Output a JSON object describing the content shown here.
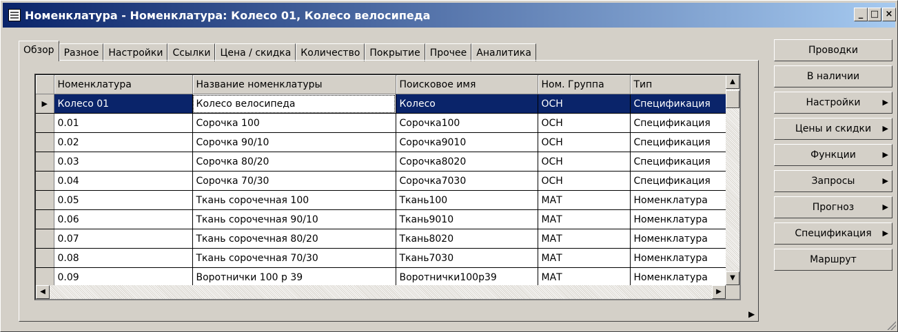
{
  "window": {
    "title": "Номенклатура - Номенклатура: Колесо 01, Колесо велосипеда",
    "minimize": "_",
    "maximize": "□",
    "close": "×"
  },
  "tabs": [
    "Обзор",
    "Разное",
    "Настройки",
    "Ссылки",
    "Цена / скидка",
    "Количество",
    "Покрытие",
    "Прочее",
    "Аналитика"
  ],
  "grid": {
    "columns": [
      "Номенклатура",
      "Название номенклатуры",
      "Поисковое имя",
      "Ном. Группа",
      "Тип"
    ],
    "rows": [
      [
        "Колесо 01",
        "Колесо велосипеда",
        "Колесо",
        "ОСН",
        "Спецификация"
      ],
      [
        "0.01",
        "Сорочка 100",
        "Сорочка100",
        "ОСН",
        "Спецификация"
      ],
      [
        "0.02",
        "Сорочка 90/10",
        "Сорочка9010",
        "ОСН",
        "Спецификация"
      ],
      [
        "0.03",
        "Сорочка 80/20",
        "Сорочка8020",
        "ОСН",
        "Спецификация"
      ],
      [
        "0.04",
        "Сорочка 70/30",
        "Сорочка7030",
        "ОСН",
        "Спецификация"
      ],
      [
        "0.05",
        "Ткань сорочечная 100",
        "Ткань100",
        "МАТ",
        "Номенклатура"
      ],
      [
        "0.06",
        "Ткань сорочечная 90/10",
        "Ткань9010",
        "МАТ",
        "Номенклатура"
      ],
      [
        "0.07",
        "Ткань сорочечная 80/20",
        "Ткань8020",
        "МАТ",
        "Номенклатура"
      ],
      [
        "0.08",
        "Ткань сорочечная 70/30",
        "Ткань7030",
        "МАТ",
        "Номенклатура"
      ],
      [
        "0.09",
        "Воротнички 100 р 39",
        "Воротнички100р39",
        "МАТ",
        "Номенклатура"
      ]
    ]
  },
  "side_buttons": [
    {
      "label": "Проводки",
      "submenu": false
    },
    {
      "label": "В наличии",
      "submenu": false
    },
    {
      "label": "Настройки",
      "submenu": true
    },
    {
      "label": "Цены и скидки",
      "submenu": true
    },
    {
      "label": "Функции",
      "submenu": true
    },
    {
      "label": "Запросы",
      "submenu": true
    },
    {
      "label": "Прогноз",
      "submenu": true
    },
    {
      "label": "Спецификация",
      "submenu": true
    },
    {
      "label": "Маршрут",
      "submenu": false
    }
  ],
  "icons": {
    "submenu_arrow": "▶",
    "row_pointer": "▶",
    "scroll_up": "▲",
    "scroll_down": "▼",
    "scroll_left": "◀",
    "scroll_right": "▶"
  }
}
